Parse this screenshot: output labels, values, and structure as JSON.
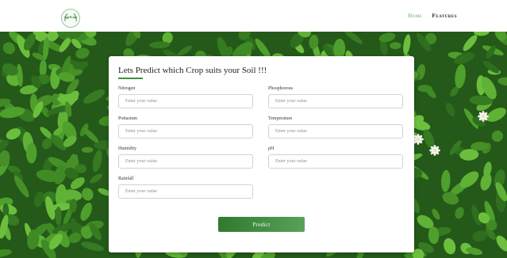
{
  "nav": {
    "logo_text": "AgriCare",
    "home_label": "Home",
    "features_label": "Features"
  },
  "form": {
    "title": "Lets Predict which Crop suits your Soil !!!",
    "fields": [
      {
        "label": "Nitrogen",
        "placeholder": "Enter your value",
        "value": ""
      },
      {
        "label": "Phosphorous",
        "placeholder": "Enter your value",
        "value": ""
      },
      {
        "label": "Pottasium",
        "placeholder": "Enter your value",
        "value": ""
      },
      {
        "label": "Temperature",
        "placeholder": "Enter your value",
        "value": ""
      },
      {
        "label": "Humidity",
        "placeholder": "Enter your value",
        "value": ""
      },
      {
        "label": "pH",
        "placeholder": "Enter your value",
        "value": ""
      },
      {
        "label": "Rainfall",
        "placeholder": "Enter your value",
        "value": ""
      }
    ],
    "submit_label": "Predict"
  },
  "colors": {
    "accent": "#4caf50",
    "button_start": "#2f7a2f",
    "button_end": "#5aa15a",
    "background_green": "#2c6b1f"
  },
  "icons": {
    "logo": "leaf-wreath-logo-icon"
  }
}
